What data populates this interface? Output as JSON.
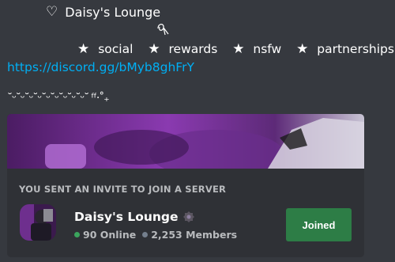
{
  "message": {
    "title_icon": "heart-outline-icon",
    "title": "Daisy's Lounge",
    "deco_icon": "bow-doodle-icon",
    "star_icon": "★",
    "categories": [
      "social",
      "rewards",
      "nsfw",
      "partnerships"
    ],
    "invite_url": "https://discord.gg/bMyb8ghFrY",
    "divider_text": "˘ᵕ˘ᵕ˘ᵕ˘ᵕ˘ᵕ˘ᵕ˘ᵕ˘ᵕ˘ᵕ˘ ᶠᶠ·˚₊"
  },
  "invite_card": {
    "heading": "YOU SENT AN INVITE TO JOIN A SERVER",
    "server_name": "Daisy's Lounge",
    "badge_icon": "verified-badge-icon",
    "online_count": "90 Online",
    "member_count": "2,253 Members",
    "button_label": "Joined",
    "colors": {
      "card_bg": "#2f3136",
      "button": "#2d7d46",
      "online": "#3ba55d",
      "link": "#00aff4",
      "banner_tint": "#7a2ea0"
    }
  }
}
